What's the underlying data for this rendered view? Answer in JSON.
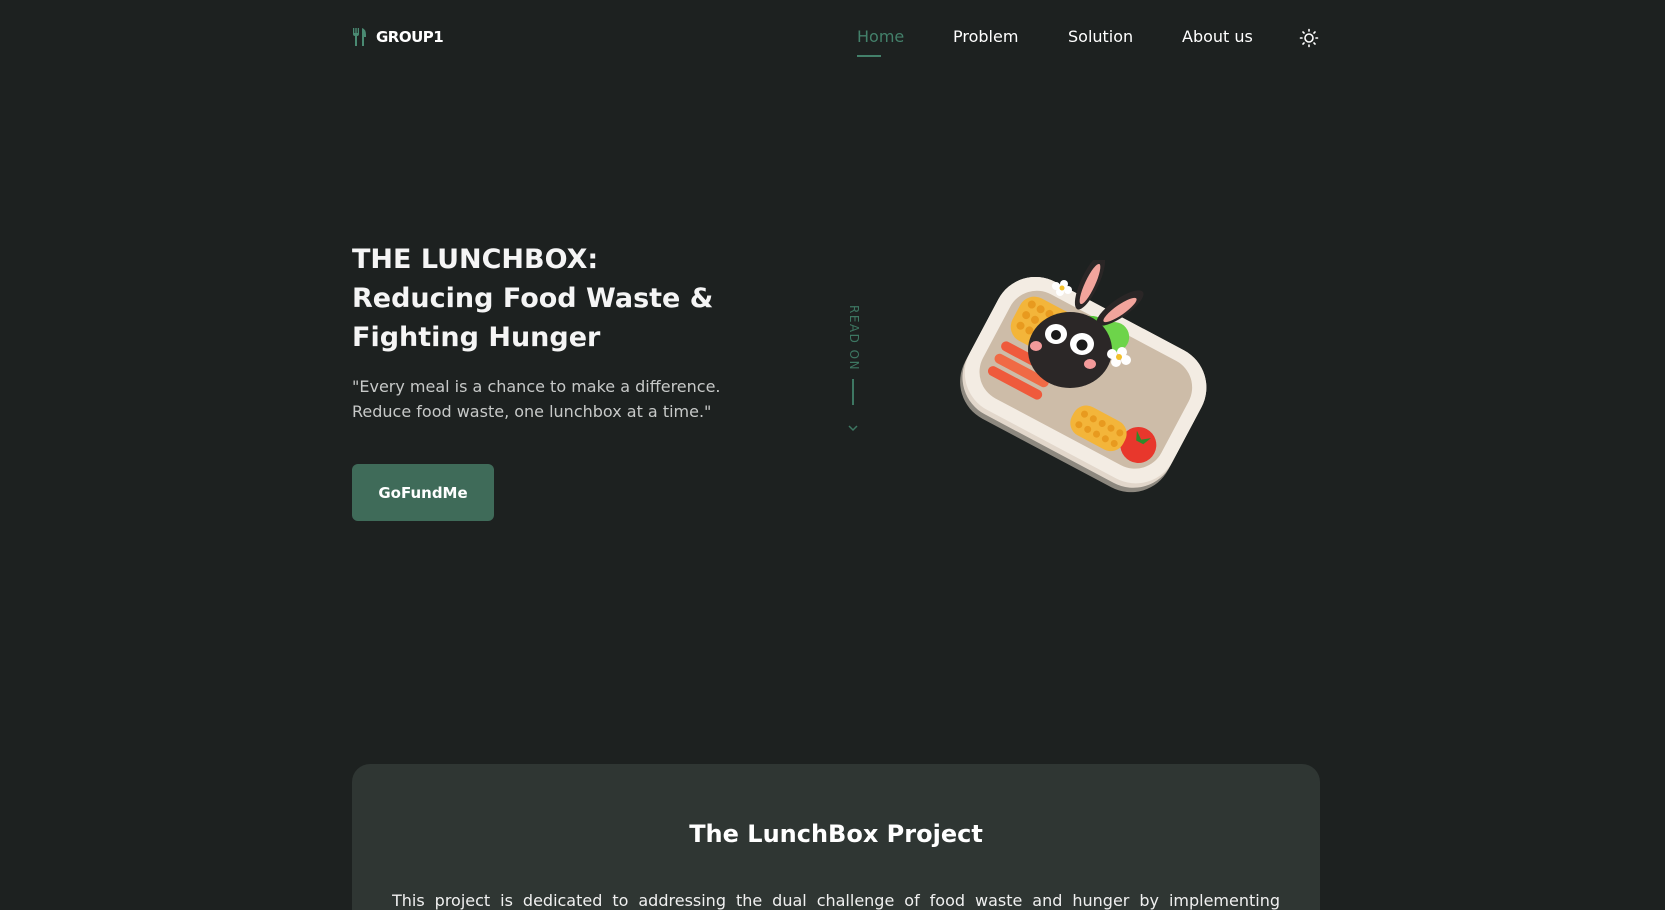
{
  "header": {
    "logo_text": "GROUP1",
    "logo_icon": "fork-knife-icon",
    "nav": [
      {
        "label": "Home",
        "active": true
      },
      {
        "label": "Problem",
        "active": false
      },
      {
        "label": "Solution",
        "active": false
      },
      {
        "label": "About us",
        "active": false
      }
    ],
    "theme_icon": "sun-icon"
  },
  "hero": {
    "title_line1": "THE LUNCHBOX:",
    "title_line2": "Reducing Food Waste &",
    "title_line3": "Fighting Hunger",
    "quote_line1": "\"Every meal is a chance to make a difference.",
    "quote_line2": "Reduce food waste, one lunchbox at a time.\"",
    "cta_label": "GoFundMe",
    "read_on_label": "READ ON",
    "illustration": "lunchbox-bunny-illustration"
  },
  "project": {
    "title": "The LunchBox Project",
    "text": "This project is dedicated to addressing the dual challenge of food waste and hunger by implementing"
  },
  "colors": {
    "background": "#1d2120",
    "accent": "#43806a",
    "button": "#3f6b59",
    "card": "#2f3633"
  }
}
